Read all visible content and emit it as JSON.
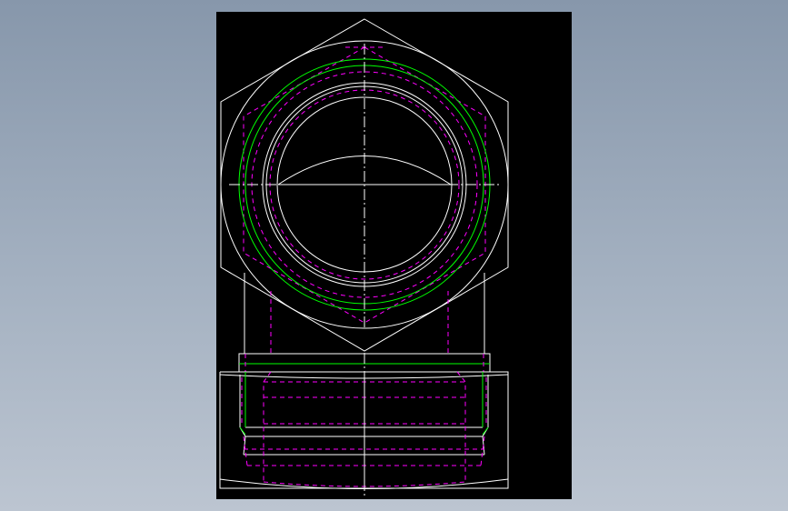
{
  "colors": {
    "background_top": "#8797ab",
    "background_bottom": "#bcc5d1",
    "canvas": "#000000",
    "outline": "#ffffff",
    "thread": "#00ff00",
    "hidden": "#ff00ff"
  },
  "drawing": {
    "views": [
      "top-view",
      "front-view"
    ],
    "line_types": [
      "visible-outline",
      "hidden-dashed",
      "center-line",
      "thread-circle"
    ]
  }
}
